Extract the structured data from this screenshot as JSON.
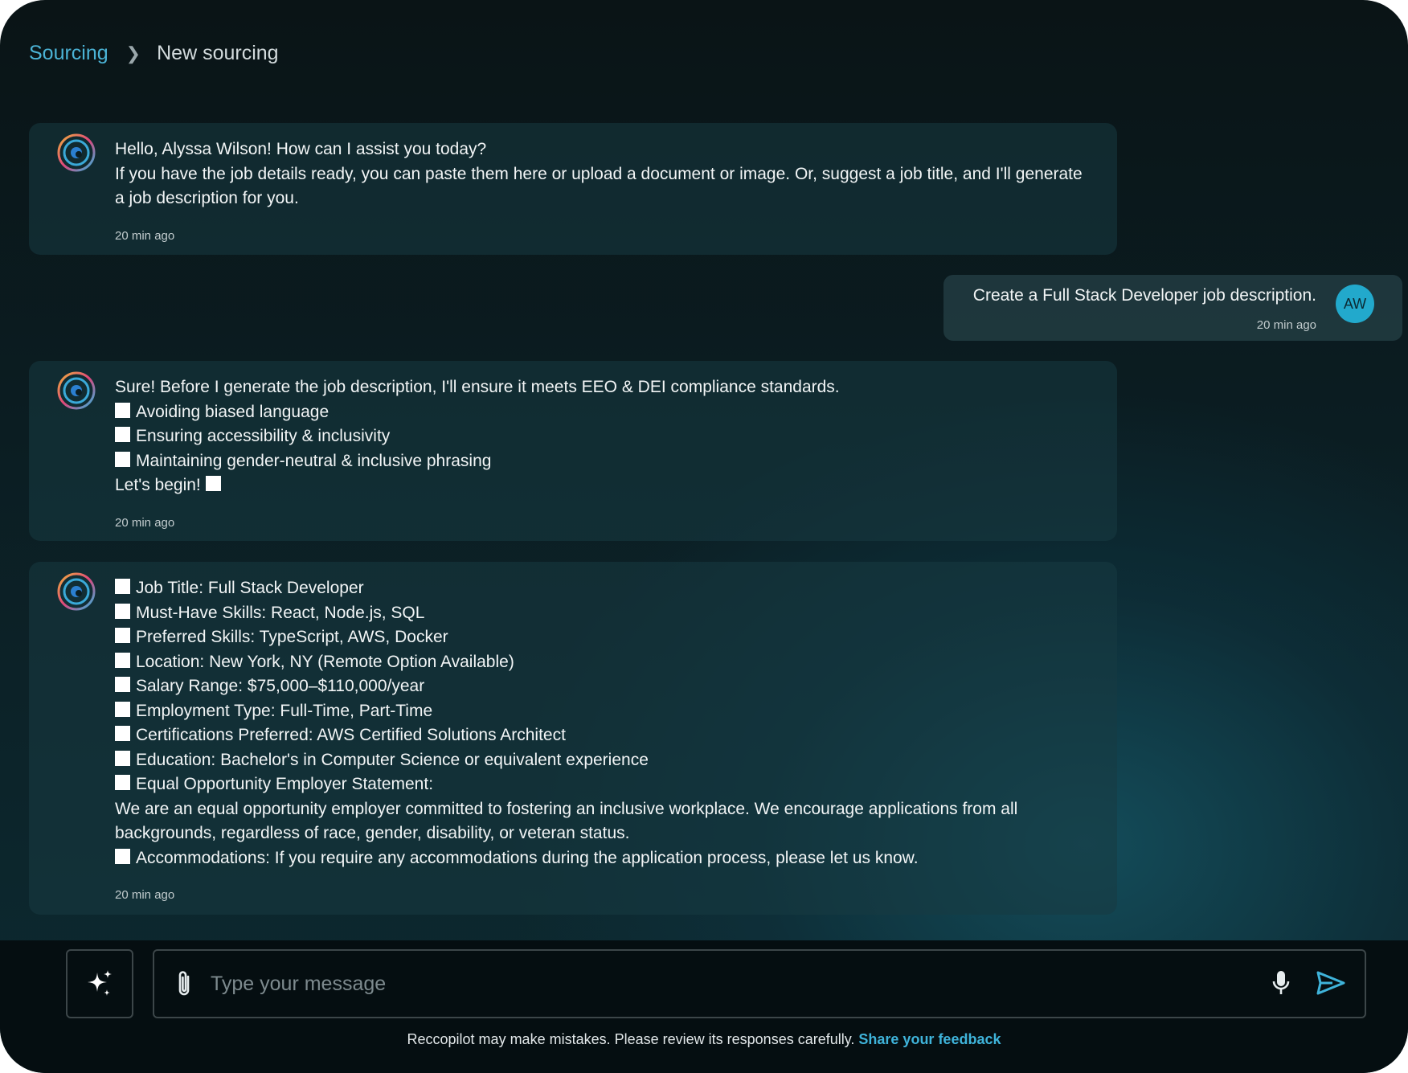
{
  "breadcrumb": {
    "parent": "Sourcing",
    "current": "New sourcing"
  },
  "messages": [
    {
      "lines": [
        "Hello, Alyssa Wilson! How can I assist you today?",
        "If you have the job details ready, you can paste them here or upload a document or image. Or, suggest a job title, and I'll generate a job description for you."
      ],
      "time": "20 min ago"
    },
    {
      "text": "Create a Full Stack Developer job description.",
      "time": "20 min ago",
      "avatar_initials": "AW"
    },
    {
      "intro": "Sure! Before I generate the job description, I'll ensure it meets EEO & DEI compliance standards.",
      "items": [
        "Avoiding biased language",
        "Ensuring accessibility & inclusivity",
        "Maintaining gender-neutral & inclusive phrasing"
      ],
      "outro": "Let's begin!",
      "time": "20 min ago"
    },
    {
      "items": [
        "Job Title: Full Stack Developer",
        "Must-Have Skills: React, Node.js, SQL",
        "Preferred Skills: TypeScript, AWS, Docker",
        "Location: New York, NY (Remote Option Available)",
        "Salary Range: $75,000–$110,000/year",
        "Employment Type: Full-Time, Part-Time",
        "Certifications Preferred: AWS Certified Solutions Architect",
        "Education: Bachelor's in Computer Science or equivalent experience",
        "Equal Opportunity Employer Statement:"
      ],
      "statement": "We are an equal opportunity employer committed to fostering an inclusive workplace. We encourage applications from all backgrounds, regardless of race, gender, disability, or veteran status.",
      "accommodations": "Accommodations: If you require any accommodations during the application process, please let us know.",
      "time": "20 min ago"
    }
  ],
  "composer": {
    "placeholder": "Type your message"
  },
  "footer": {
    "disclaimer": "Reccopilot may make mistakes. Please review its responses carefully.",
    "feedback_link": "Share your feedback"
  },
  "icons": {
    "bot_avatar": "assistant-logo-icon",
    "sparkle": "sparkle-icon",
    "attach": "paperclip-icon",
    "mic": "microphone-icon",
    "send": "send-icon",
    "checkbox": "white-square-glyph"
  },
  "colors": {
    "accent": "#4bb3d6",
    "avatar_bg": "#22a9cc"
  }
}
